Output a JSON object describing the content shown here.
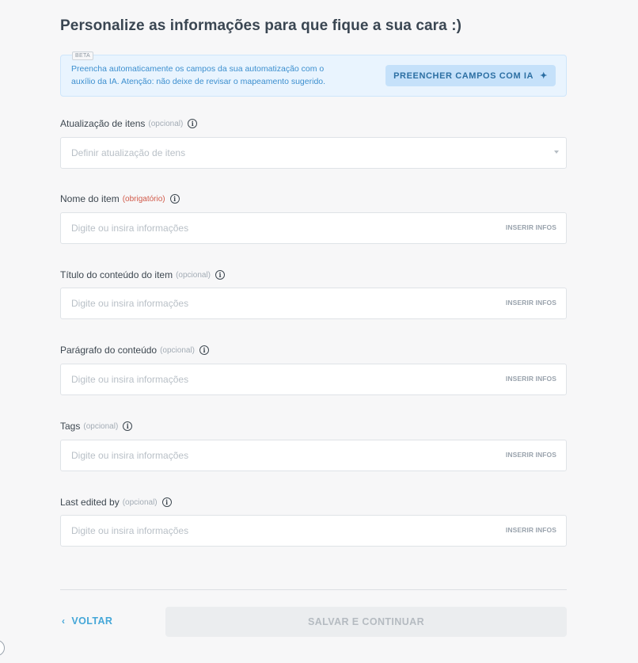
{
  "header": {
    "title": "Personalize as informações para que fique a sua cara :)"
  },
  "ai_banner": {
    "beta_label": "BETA",
    "text_line1": "Preencha automaticamente os campos da sua automatização com o",
    "text_line2": "auxílio da IA. Atenção: não deixe de revisar o mapeamento sugerido.",
    "button_label": "PREENCHER CAMPOS COM IA",
    "button_icon": "sparkle-icon"
  },
  "fields": {
    "item_update": {
      "label": "Atualização de itens",
      "tag": "(opcional)",
      "placeholder": "Definir atualização de itens"
    },
    "item_name": {
      "label": "Nome do item",
      "tag": "(obrigatório)",
      "placeholder": "Digite ou insira informações",
      "action": "INSERIR INFOS"
    },
    "content_title": {
      "label": "Título do conteúdo do item",
      "tag": "(opcional)",
      "placeholder": "Digite ou insira informações",
      "action": "INSERIR INFOS"
    },
    "content_paragraph": {
      "label": "Parágrafo do conteúdo",
      "tag": "(opcional)",
      "placeholder": "Digite ou insira informações",
      "action": "INSERIR INFOS"
    },
    "tags": {
      "label": "Tags",
      "tag": "(opcional)",
      "placeholder": "Digite ou insira informações",
      "action": "INSERIR INFOS"
    },
    "last_edited_by": {
      "label": "Last edited by",
      "tag": "(opcional)",
      "placeholder": "Digite ou insira informações",
      "action": "INSERIR INFOS"
    }
  },
  "footer": {
    "back_label": "VOLTAR",
    "save_label": "SALVAR E CONTINUAR"
  },
  "colors": {
    "accent": "#45a7d8",
    "required": "#d15a4a",
    "banner_bg": "#e9f4fe"
  }
}
